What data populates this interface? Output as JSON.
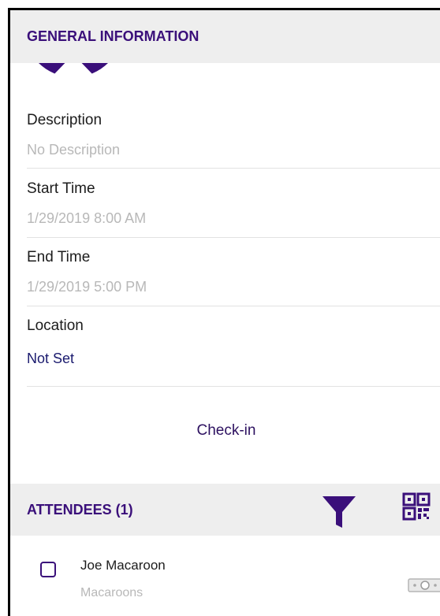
{
  "general_information": {
    "title": "GENERAL INFORMATION",
    "fields": [
      {
        "label": "Description",
        "value": "No Description"
      },
      {
        "label": "Start Time",
        "value": "1/29/2019 8:00 AM"
      },
      {
        "label": "End Time",
        "value": "1/29/2019 5:00 PM"
      },
      {
        "label": "Location",
        "value": "Not Set"
      }
    ],
    "checkin_label": "Check-in"
  },
  "attendees": {
    "title": "ATTENDEES (1)",
    "items": [
      {
        "name": "Joe Macaroon",
        "organization": "Macaroons",
        "checked": false
      }
    ]
  },
  "icons": {
    "avatar": "avatar-icon",
    "filter": "filter-icon",
    "qr": "qr-code-icon",
    "money": "money-icon"
  },
  "colors": {
    "accent": "#3a0f7a",
    "header_bg": "#eeeeee",
    "muted_text": "#b8b8b8",
    "link_text": "#1a1a6e"
  }
}
